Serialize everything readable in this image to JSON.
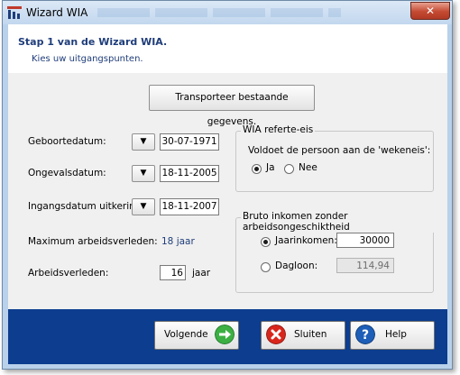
{
  "window": {
    "title": "Wizard WIA",
    "close_glyph": "✕"
  },
  "header": {
    "title": "Stap 1 van de Wizard WIA.",
    "subtitle": "Kies uw uitgangspunten."
  },
  "transport_button": "Transporteer bestaande gegevens.",
  "fields": {
    "geboortedatum": {
      "label": "Geboortedatum:",
      "value": "30-07-1971"
    },
    "ongevalsdatum": {
      "label": "Ongevalsdatum:",
      "value": "18-11-2005"
    },
    "ingangsdatum": {
      "label": "Ingangsdatum uitkering:",
      "value": "18-11-2007"
    },
    "max_arbeidsverleden": {
      "label": "Maximum arbeidsverleden:",
      "value": "18 jaar"
    },
    "arbeidsverleden": {
      "label": "Arbeidsverleden:",
      "value": "16",
      "unit": "jaar"
    },
    "dropdown_glyph": "▼"
  },
  "wia_referte": {
    "legend": "WIA referte-eis",
    "question": "Voldoet de persoon aan de 'wekeneis':",
    "options": [
      {
        "label": "Ja",
        "selected": true
      },
      {
        "label": "Nee",
        "selected": false
      }
    ]
  },
  "bruto_inkomen": {
    "legend": "Bruto inkomen zonder arbeidsongeschiktheid",
    "jaarinkomen": {
      "label": "Jaarinkomen:",
      "value": "30000",
      "selected": true
    },
    "dagloon": {
      "label": "Dagloon:",
      "value": "114,94",
      "selected": false
    }
  },
  "footer": {
    "next": {
      "label": "Volgende",
      "icon": "arrow-right-icon",
      "color": "#3cb043"
    },
    "close": {
      "label": "Sluiten",
      "icon": "close-circle-icon",
      "color": "#d9261c"
    },
    "help": {
      "label": "Help",
      "icon": "help-icon",
      "color": "#1d5fb8"
    }
  }
}
